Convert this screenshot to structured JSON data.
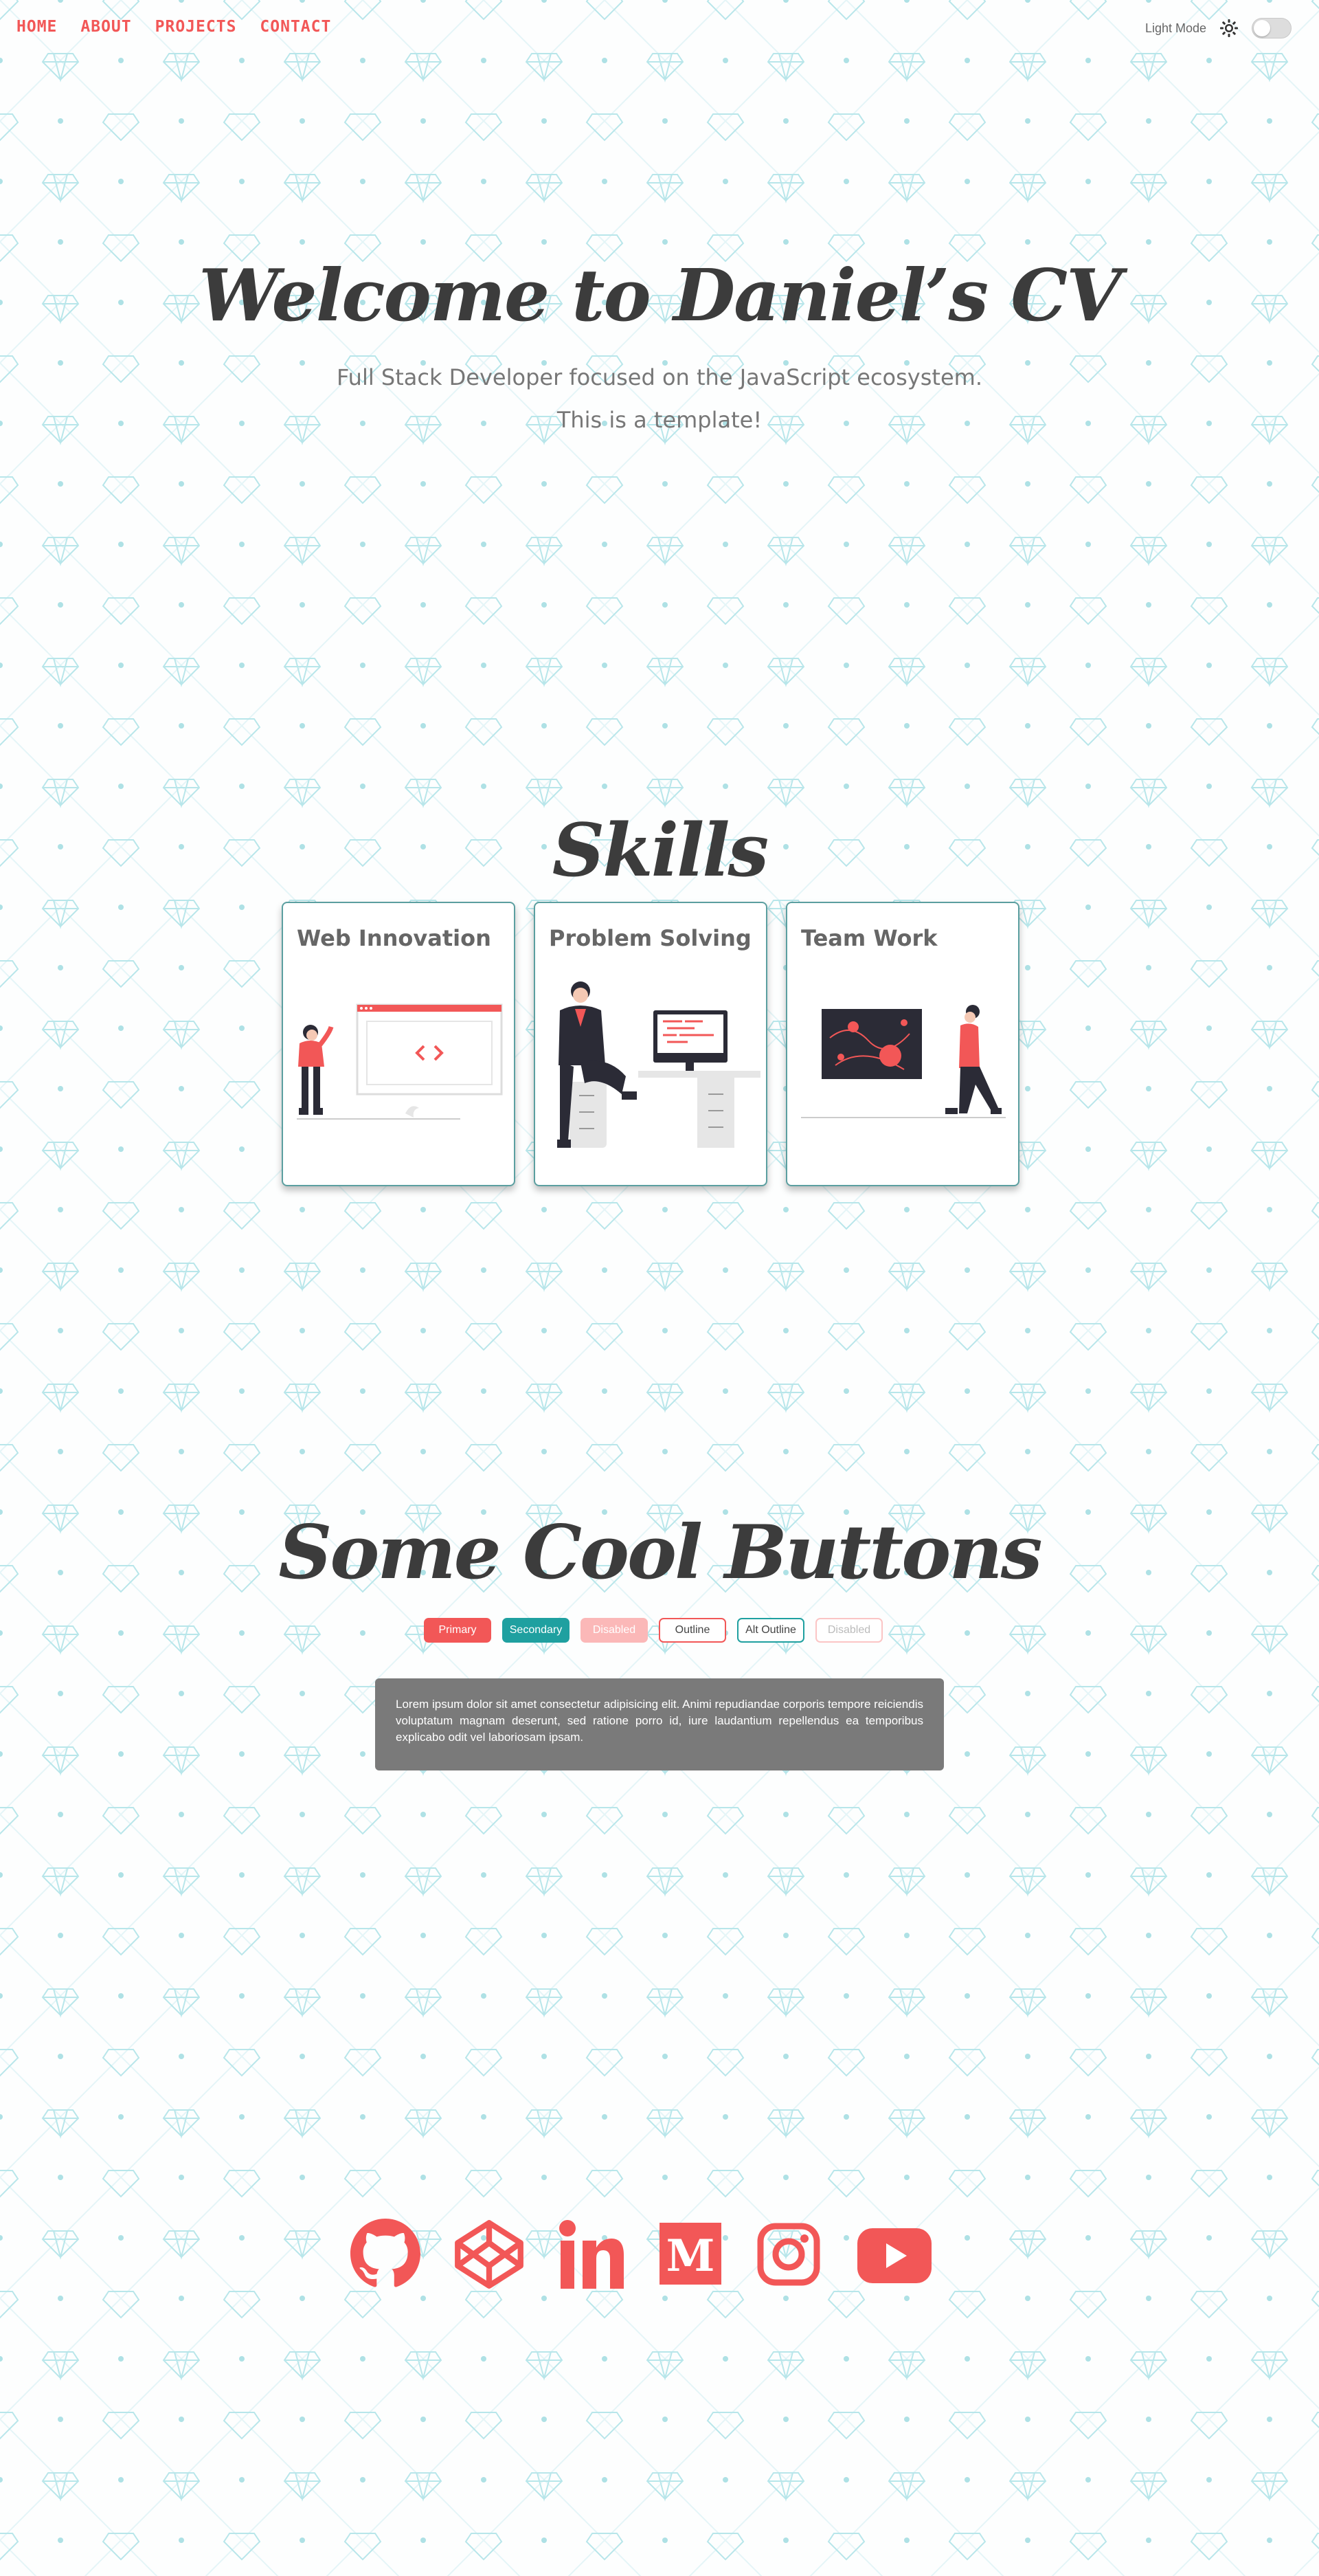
{
  "nav": {
    "links": [
      "HOME",
      "ABOUT",
      "PROJECTS",
      "CONTACT"
    ],
    "mode_label": "Light Mode"
  },
  "hero": {
    "title": "Welcome to Daniel’s CV",
    "subtitle": "Full Stack Developer focused on the JavaScript ecosystem.",
    "note": "This is a template!"
  },
  "skills": {
    "title": "Skills",
    "cards": [
      {
        "title": "Web Innovation"
      },
      {
        "title": "Problem Solving"
      },
      {
        "title": "Team Work"
      }
    ]
  },
  "buttons": {
    "title": "Some Cool Buttons",
    "items": [
      "Primary",
      "Secondary",
      "Disabled",
      "Outline",
      "Alt Outline",
      "Disabled"
    ],
    "text": "Lorem ipsum dolor sit amet consectetur adipisicing elit. Animi repudiandae corporis tempore reiciendis voluptatum magnam deserunt, sed ratione porro id, iure laudantium repellendus ea temporibus explicabo odit vel laboriosam ipsam."
  },
  "social": {
    "icons": [
      "github-icon",
      "codepen-icon",
      "linkedin-icon",
      "medium-icon",
      "instagram-icon",
      "youtube-icon"
    ]
  },
  "colors": {
    "accent": "#f25757",
    "secondary": "#1fa0a0",
    "text": "#3c3c3c",
    "pattern": "#bfe9ec"
  }
}
